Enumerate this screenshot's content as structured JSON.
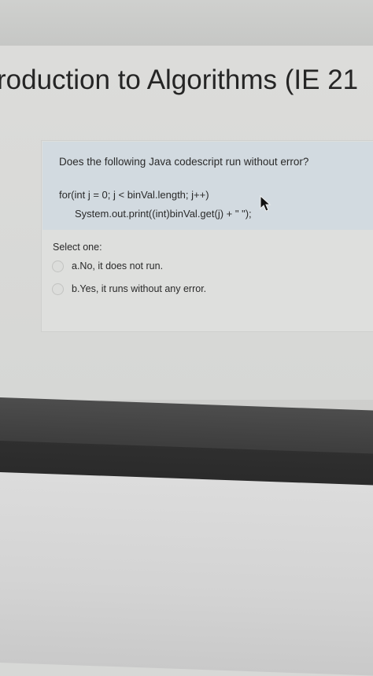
{
  "page": {
    "title": "roduction to Algorithms (IE 21"
  },
  "question": {
    "text": "Does the following Java codescript run without error?",
    "code_line1": "for(int j = 0; j < binVal.length; j++)",
    "code_line2": "System.out.print((int)binVal.get(j) + \" \");",
    "select_label": "Select one:",
    "options": [
      {
        "label": "a.No, it does not run."
      },
      {
        "label": "b.Yes, it runs without any error."
      }
    ]
  },
  "colors": {
    "text": "#2a2a2a",
    "question_box": "#d2dae0",
    "page_background": "#d7d8d6"
  }
}
